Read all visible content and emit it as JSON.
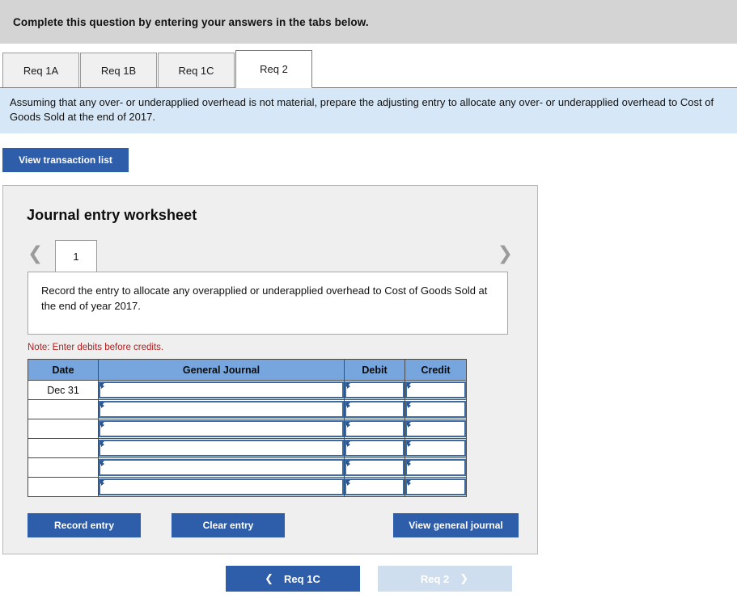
{
  "top_banner": {
    "text": "Complete this question by entering your answers in the tabs below."
  },
  "tabs": [
    {
      "label": "Req 1A",
      "active": false
    },
    {
      "label": "Req 1B",
      "active": false
    },
    {
      "label": "Req 1C",
      "active": false
    },
    {
      "label": "Req 2",
      "active": true
    }
  ],
  "instruction": {
    "text": "Assuming that any over- or underapplied overhead is not material, prepare the adjusting entry to allocate any over- or underapplied overhead to Cost of Goods Sold at the end of 2017."
  },
  "transaction_button": {
    "label": "View transaction list"
  },
  "worksheet": {
    "title": "Journal entry worksheet",
    "pager": {
      "prev_icon": "chevron-left",
      "next_icon": "chevron-right",
      "current_page": "1"
    },
    "entry_description": "Record the entry to allocate any overapplied or underapplied overhead to Cost of Goods Sold at the end of year 2017.",
    "note": "Note: Enter debits before credits.",
    "table": {
      "columns": [
        "Date",
        "General Journal",
        "Debit",
        "Credit"
      ],
      "rows": [
        {
          "date": "Dec 31",
          "general_journal": "",
          "debit": "",
          "credit": ""
        },
        {
          "date": "",
          "general_journal": "",
          "debit": "",
          "credit": ""
        },
        {
          "date": "",
          "general_journal": "",
          "debit": "",
          "credit": ""
        },
        {
          "date": "",
          "general_journal": "",
          "debit": "",
          "credit": ""
        },
        {
          "date": "",
          "general_journal": "",
          "debit": "",
          "credit": ""
        },
        {
          "date": "",
          "general_journal": "",
          "debit": "",
          "credit": ""
        }
      ]
    },
    "actions": {
      "record_label": "Record entry",
      "clear_label": "Clear entry",
      "view_journal_label": "View general journal"
    }
  },
  "bottom_nav": {
    "prev": {
      "label": "Req 1C",
      "icon": "chevron-left",
      "disabled": false
    },
    "next": {
      "label": "Req 2",
      "icon": "chevron-right",
      "disabled": true
    }
  },
  "colors": {
    "banner_gray": "#d4d4d4",
    "instruction_blue": "#d6e8f7",
    "button_blue": "#2e5da9",
    "button_blue_disabled": "#cfdeee",
    "table_header_blue": "#77a5dd",
    "input_border_blue": "#3b6ba5",
    "note_red": "#b02020",
    "panel_gray": "#efefef"
  }
}
